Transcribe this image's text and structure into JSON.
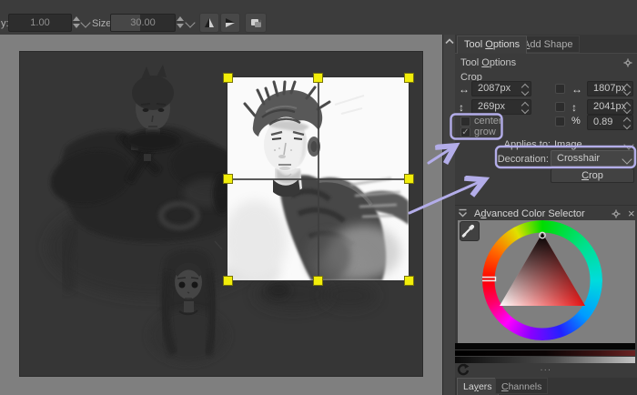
{
  "toolbar": {
    "opacity_label": "y:",
    "opacity_value": "1.00",
    "size_label": "Size:",
    "size_value": "30.00"
  },
  "panel": {
    "tabs": {
      "tool_options": {
        "pre": "Tool ",
        "mn": "O",
        "post": "ptions"
      },
      "add_shape": {
        "pre": "",
        "mn": "A",
        "post": "dd Shape"
      }
    },
    "header": {
      "pre": "Tool ",
      "mn": "O",
      "post": "ptions"
    },
    "section_label": "Crop",
    "x_value": "2087px",
    "y_value": "269px",
    "width_value": "1807px",
    "height_value": "2041px",
    "percent_symbol": "%",
    "percent_value": "0.89",
    "center_label": "center",
    "grow_label": "grow",
    "grow_check": "✓",
    "x_icon": "↔",
    "y_icon": "↕",
    "width_icon": "↔",
    "height_icon": "↕",
    "applies_label": "Applies to:",
    "applies_value": "Image",
    "decoration_label": "Decoration:",
    "decoration_value": "Crosshair",
    "crop_button": {
      "pre": "",
      "mn": "C",
      "post": "rop"
    }
  },
  "color_selector": {
    "title": {
      "pre": "A",
      "mn": "d",
      "post": "vanced Color Selector"
    },
    "close_glyph": "×",
    "dots": "...",
    "tabs": {
      "layers": {
        "pre": "La",
        "mn": "y",
        "post": "ers"
      },
      "channels": {
        "pre": "",
        "mn": "C",
        "post": "hannels"
      }
    }
  },
  "colors": {
    "annotation": "#b3ade9",
    "handle_yellow": "#f2ee0a",
    "panel_bg": "#3b3b3b",
    "canvas_bg": "#7f7f7f",
    "triangle_hue": "#e81010"
  }
}
